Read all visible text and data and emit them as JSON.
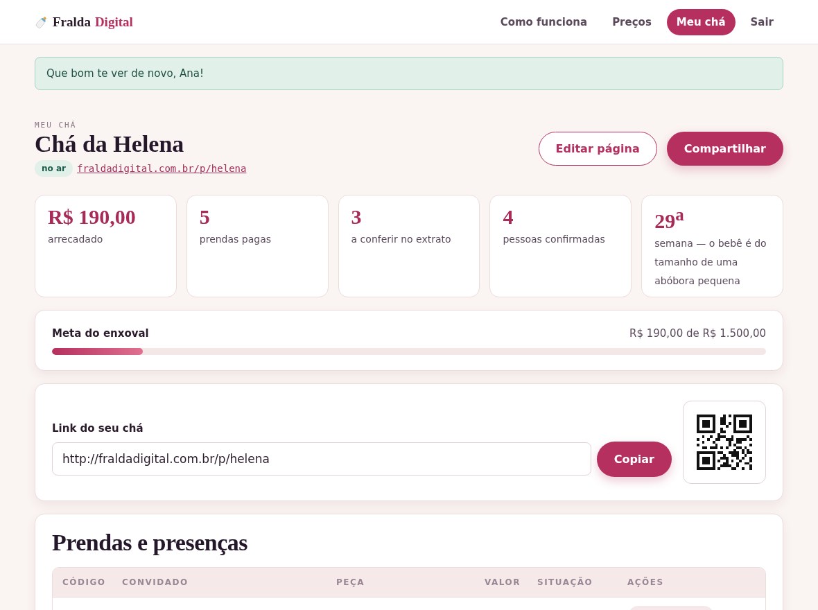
{
  "brand": {
    "first": "Fralda",
    "second": "Digital"
  },
  "nav": [
    {
      "label": "Como funciona",
      "selected": false
    },
    {
      "label": "Preços",
      "selected": false
    },
    {
      "label": "Meu chá",
      "selected": true
    },
    {
      "label": "Sair",
      "selected": false
    }
  ],
  "alert": "Que bom te ver de novo, Ana!",
  "header": {
    "eyebrow": "MEU CHÁ",
    "title": "Chá da Helena",
    "status": "no ar",
    "link": "fraldadigital.com.br/p/helena",
    "buttons": [
      {
        "label": "Editar página",
        "kind": "outline"
      },
      {
        "label": "Compartilhar",
        "kind": "primary"
      }
    ]
  },
  "stats": [
    {
      "value": "R$ 190,00",
      "label": "arrecadado"
    },
    {
      "value": "5",
      "label": "prendas pagas"
    },
    {
      "value": "3",
      "label": "a conferir no extrato"
    },
    {
      "value": "4",
      "label": "pessoas confirmadas"
    },
    {
      "value": "29$^{a}$",
      "label": "semana — o bebê é do tamanho de uma abóbora pequena"
    }
  ],
  "goal": {
    "title": "Meta do enxoval",
    "reading": "R$ 190,00 de R$ 1.500,00",
    "level": 0.127
  },
  "share": {
    "label": "Link do seu chá",
    "value": "http://fraldadigital.com.br/p/helena",
    "button": "Copiar"
  },
  "gifts": {
    "title": "Prendas e presenças",
    "columns": [
      "CÓDIGO",
      "CONVIDADO",
      "PEÇA",
      "VALOR",
      "SITUAÇÃO",
      "AÇÕES"
    ]
  }
}
